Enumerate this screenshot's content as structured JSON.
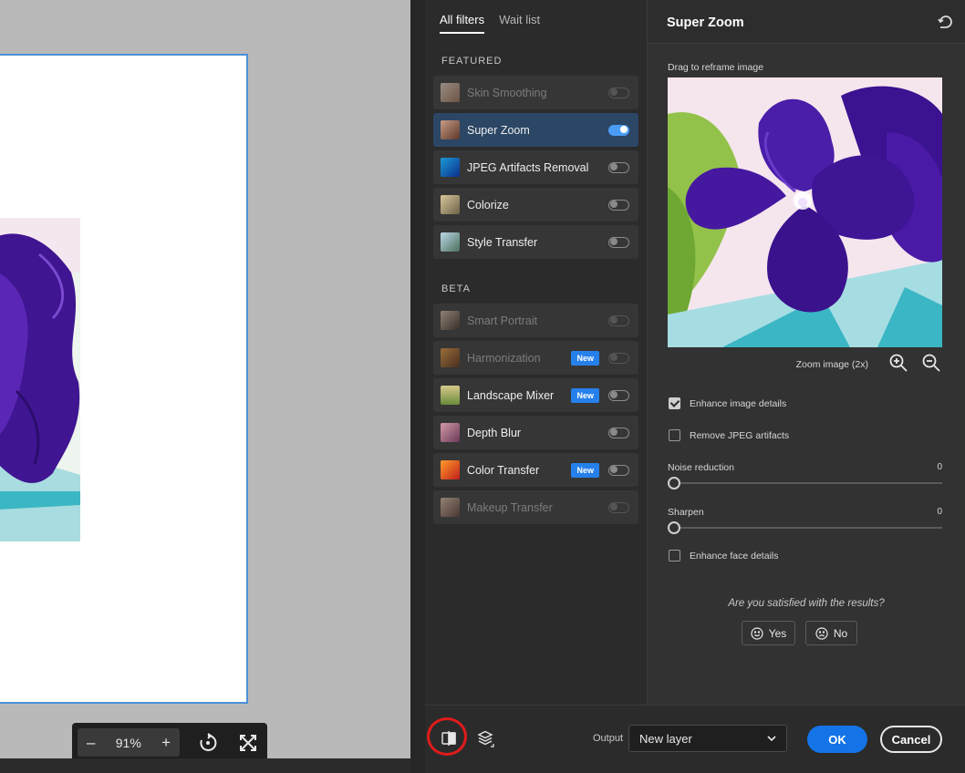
{
  "canvas": {
    "zoom": "91%"
  },
  "tabs": {
    "all_filters": "All filters",
    "wait_list": "Wait list"
  },
  "sections": {
    "featured": "FEATURED",
    "beta": "BETA"
  },
  "filters": {
    "featured": [
      {
        "name": "Skin Smoothing",
        "enabled": false,
        "available": false
      },
      {
        "name": "Super Zoom",
        "enabled": true,
        "available": true
      },
      {
        "name": "JPEG Artifacts Removal",
        "enabled": false,
        "available": true
      },
      {
        "name": "Colorize",
        "enabled": false,
        "available": true
      },
      {
        "name": "Style Transfer",
        "enabled": false,
        "available": true
      }
    ],
    "beta": [
      {
        "name": "Smart Portrait",
        "enabled": false,
        "available": false
      },
      {
        "name": "Harmonization",
        "enabled": false,
        "available": false,
        "badge": "New"
      },
      {
        "name": "Landscape Mixer",
        "enabled": false,
        "available": true,
        "badge": "New"
      },
      {
        "name": "Depth Blur",
        "enabled": false,
        "available": true
      },
      {
        "name": "Color Transfer",
        "enabled": false,
        "available": true,
        "badge": "New"
      },
      {
        "name": "Makeup Transfer",
        "enabled": false,
        "available": false
      }
    ]
  },
  "panel": {
    "title": "Super Zoom",
    "drag_hint": "Drag to reframe image",
    "zoom_label": "Zoom image (2x)",
    "options": {
      "enhance_details": {
        "label": "Enhance image details",
        "checked": true
      },
      "remove_jpeg": {
        "label": "Remove JPEG artifacts",
        "checked": false
      },
      "enhance_face": {
        "label": "Enhance face details",
        "checked": false
      }
    },
    "sliders": {
      "noise": {
        "label": "Noise reduction",
        "value": "0"
      },
      "sharpen": {
        "label": "Sharpen",
        "value": "0"
      }
    },
    "feedback": {
      "question": "Are you satisfied with the results?",
      "yes": "Yes",
      "no": "No"
    }
  },
  "footer": {
    "output_label": "Output",
    "output_value": "New layer",
    "ok": "OK",
    "cancel": "Cancel"
  },
  "colors": {
    "accent": "#1473e6",
    "selected_row": "#2c4665",
    "highlight_circle": "#e01b1b"
  }
}
